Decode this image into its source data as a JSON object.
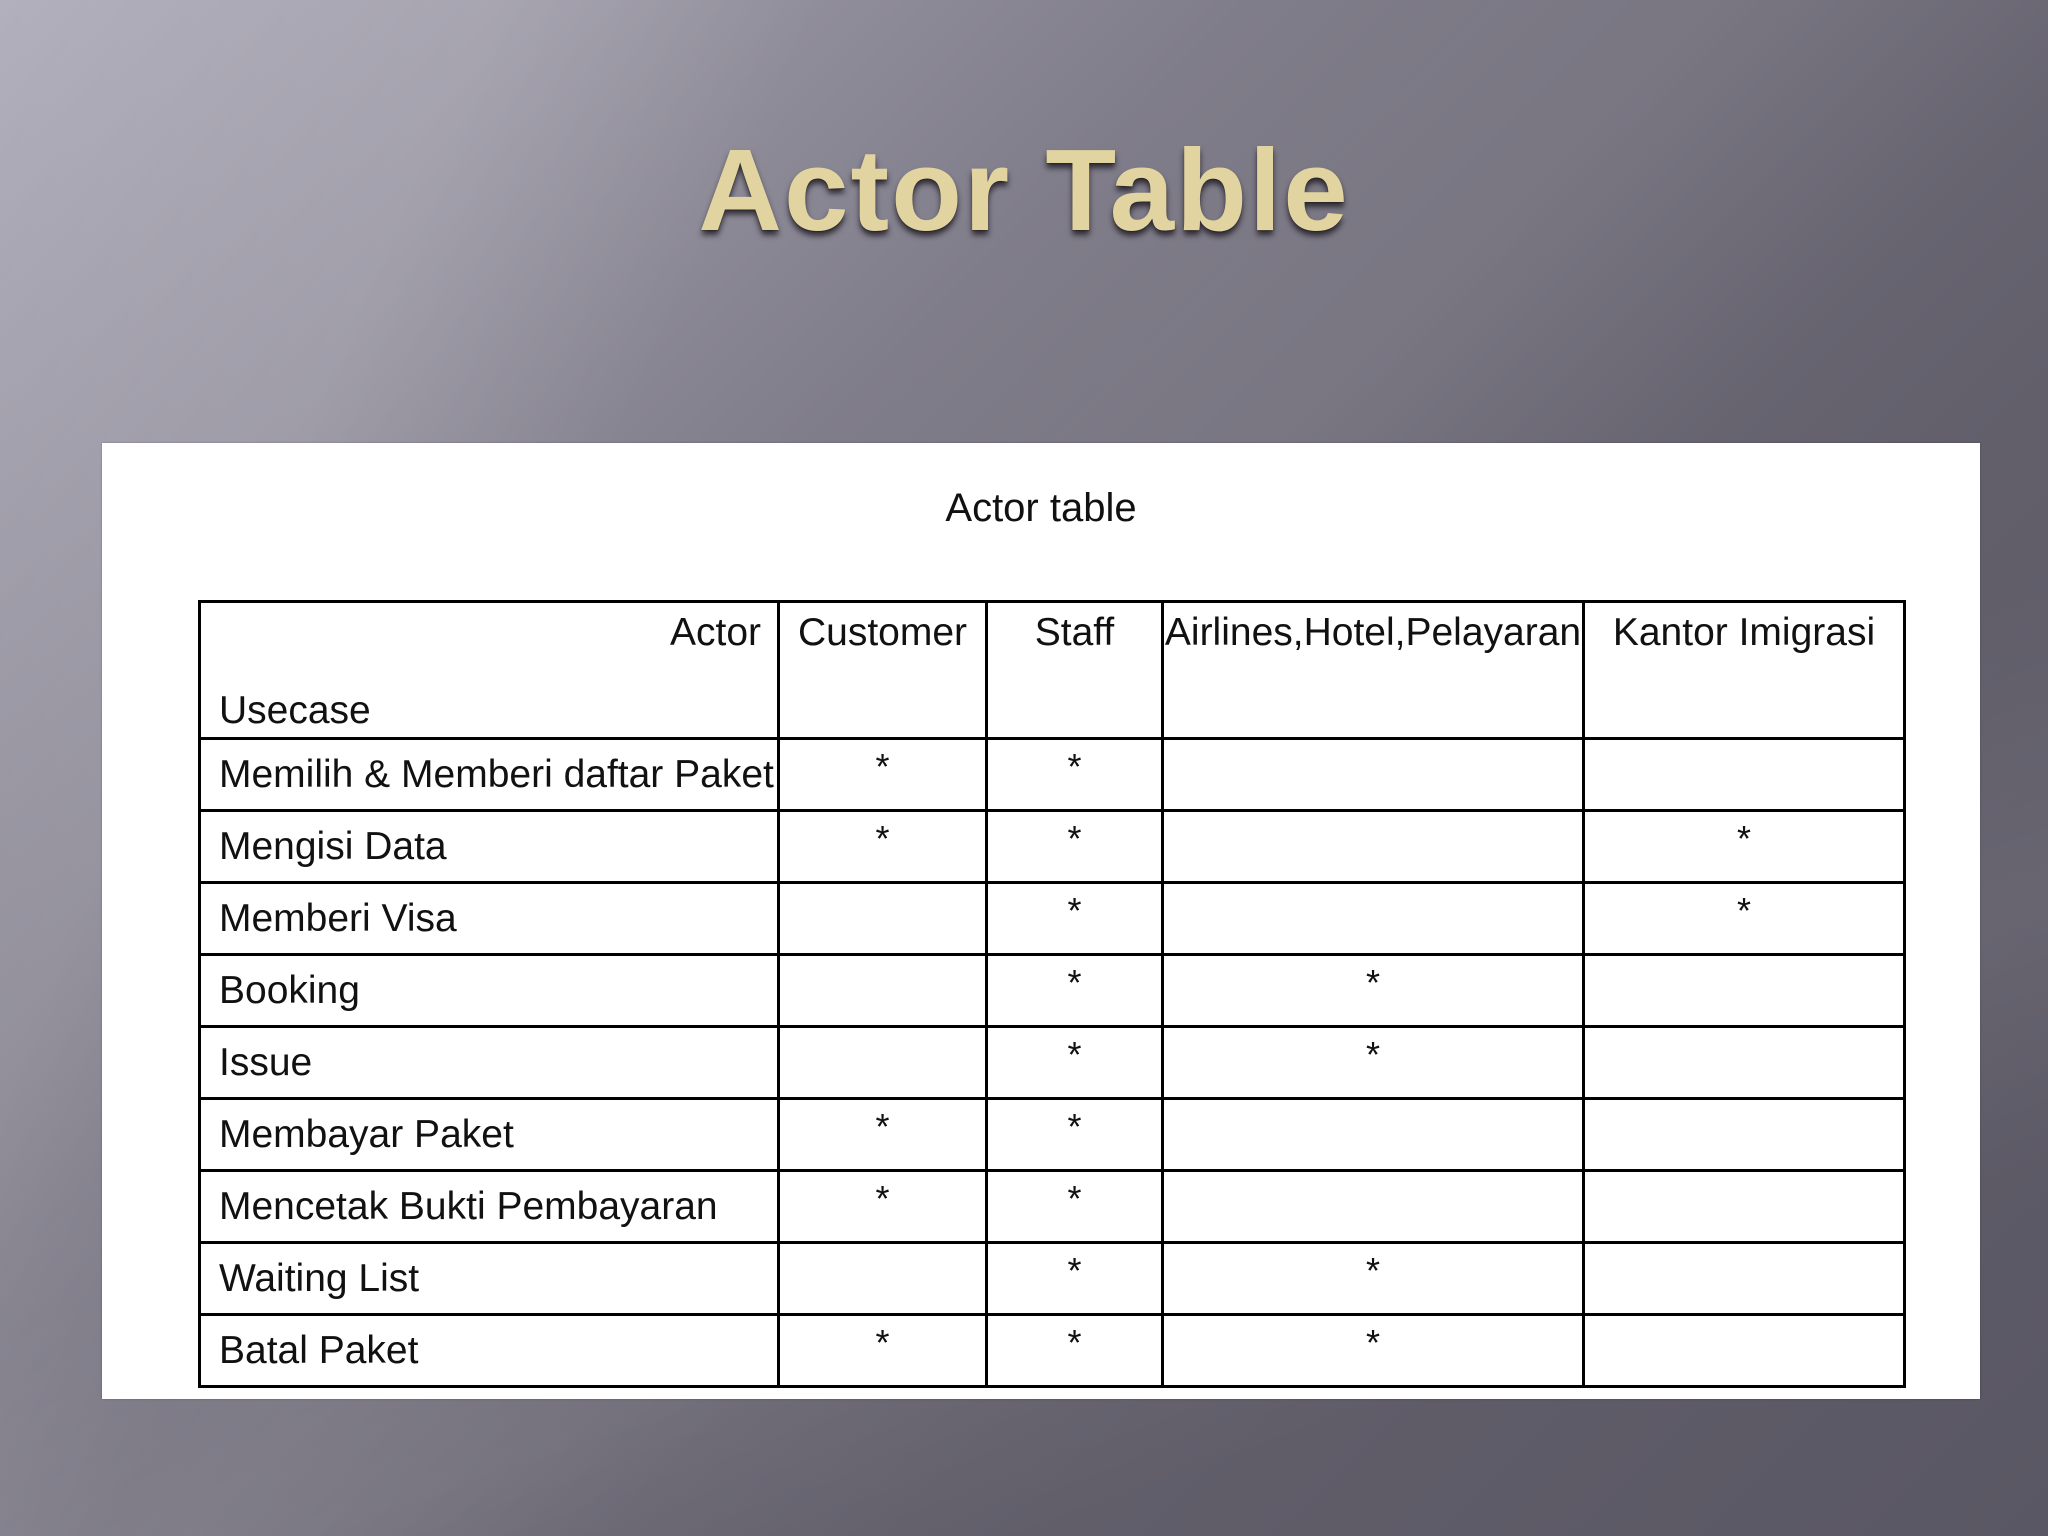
{
  "slide": {
    "title": "Actor Table"
  },
  "panel": {
    "caption": "Actor table"
  },
  "table": {
    "corner_actor": "Actor",
    "corner_usecase": "Usecase",
    "columns": [
      "Customer",
      "Staff",
      "Airlines,Hotel,Pelayaran",
      "Kantor Imigrasi"
    ],
    "rows": [
      {
        "usecase": "Memilih & Memberi daftar Paket",
        "cells": [
          "*",
          "*",
          "",
          ""
        ]
      },
      {
        "usecase": "Mengisi Data",
        "cells": [
          "*",
          "*",
          "",
          "*"
        ]
      },
      {
        "usecase": "Memberi Visa",
        "cells": [
          "",
          "*",
          "",
          "*"
        ]
      },
      {
        "usecase": "Booking",
        "cells": [
          "",
          "*",
          "*",
          ""
        ]
      },
      {
        "usecase": "Issue",
        "cells": [
          "",
          "*",
          "*",
          ""
        ]
      },
      {
        "usecase": "Membayar Paket",
        "cells": [
          "*",
          "*",
          "",
          ""
        ]
      },
      {
        "usecase": "Mencetak Bukti Pembayaran",
        "cells": [
          "*",
          "*",
          "",
          ""
        ]
      },
      {
        "usecase": "Waiting List",
        "cells": [
          "",
          "*",
          "*",
          ""
        ]
      },
      {
        "usecase": "Batal Paket",
        "cells": [
          "*",
          "*",
          "*",
          ""
        ]
      }
    ]
  },
  "colors": {
    "title": "#e1d4a1",
    "panel_background": "#ffffff",
    "table_border": "#000000",
    "text": "#111111"
  }
}
